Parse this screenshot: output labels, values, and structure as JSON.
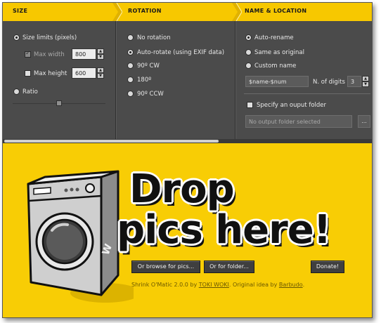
{
  "header": {
    "size_label": "SIZE",
    "rotation_label": "ROTATION",
    "name_location_label": "NAME & LOCATION",
    "accent": "#f7c800"
  },
  "size": {
    "limits_label": "Size limits (pixels)",
    "max_width_label": "Max width",
    "max_width_value": "800",
    "max_height_label": "Max height",
    "max_height_value": "600",
    "ratio_label": "Ratio"
  },
  "rotation": {
    "options": [
      "No rotation",
      "Auto-rotate (using EXIF data)",
      "90º CW",
      "180º",
      "90º CCW"
    ],
    "selected": "Auto-rotate (using EXIF data)"
  },
  "naming": {
    "auto_rename_label": "Auto-rename",
    "same_as_original_label": "Same as original",
    "custom_name_label": "Custom name",
    "pattern_value": "$name-$num",
    "digits_label": "N. of digits",
    "digits_value": "3",
    "specify_folder_label": "Specify an ouput folder",
    "folder_placeholder": "No output folder selected",
    "browse_label": "..."
  },
  "drop": {
    "line1": "Drop",
    "line2": "pics here!",
    "browse_pics_label": "Or browse for pics...",
    "folder_label": "Or for folder...",
    "donate_label": "Donate!",
    "credit_prefix": "Shrink O'Matic 2.0.0 by",
    "credit_author": "TOKI WOKI",
    "credit_middle": ". Original idea by",
    "credit_idea": "Barbudo",
    "credit_suffix": ".",
    "washer_badge": "W",
    "background": "#f8cd05"
  }
}
